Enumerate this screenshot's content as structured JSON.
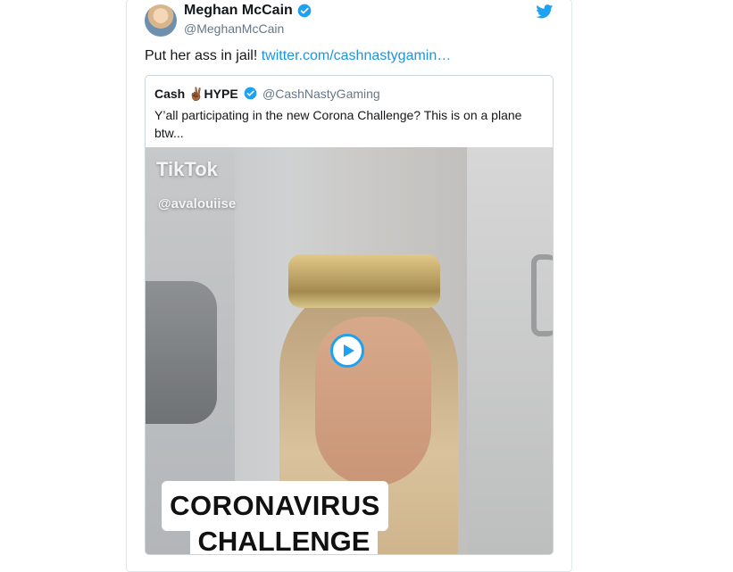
{
  "tweet": {
    "author_name": "Meghan McCain",
    "author_handle": "@MeghanMcCain",
    "text": "Put her ass in jail!",
    "link_text": "twitter.com/cashnastygamin…"
  },
  "quoted_tweet": {
    "author_name": "Cash ✌🏾HYPE",
    "author_handle": "@CashNastyGaming",
    "text": "Y’all participating in the new Corona Challenge? This is on a plane btw..."
  },
  "video": {
    "overlay_brand": "TikTok",
    "overlay_user": "@avalouiise",
    "caption_line1": "CORONAVIRUS",
    "caption_line2": "CHALLENGE"
  },
  "colors": {
    "accent": "#1da1f2",
    "link": "#1b95e0",
    "muted": "#657786"
  },
  "icons": {
    "verified": "verified-badge-icon",
    "brand": "twitter-bird-icon",
    "play": "play-icon"
  }
}
